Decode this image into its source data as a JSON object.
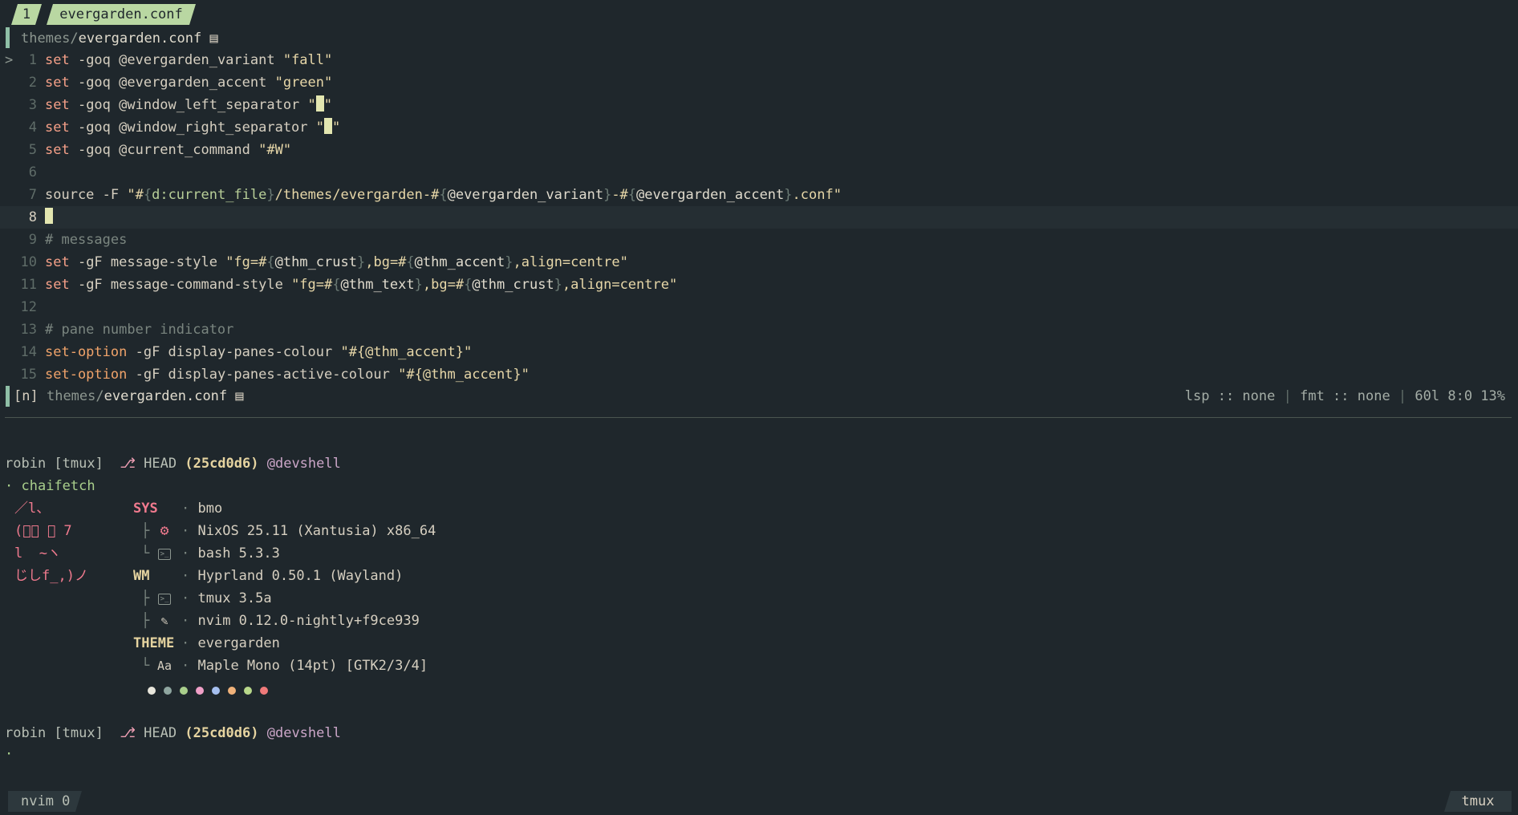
{
  "tabline": {
    "index": "1",
    "name": "evergarden.conf"
  },
  "winbar": {
    "dir": "themes/",
    "file": "evergarden.conf"
  },
  "code": {
    "l1": {
      "n": "1",
      "a": "set",
      "b": " -goq @evergarden_variant ",
      "c": "\"fall\""
    },
    "l2": {
      "n": "2",
      "a": "set",
      "b": " -goq @evergarden_accent ",
      "c": "\"green\""
    },
    "l3": {
      "n": "3",
      "a": "set",
      "b": " -goq @window_left_separator ",
      "c": "\"",
      "d": "\""
    },
    "l4": {
      "n": "4",
      "a": "set",
      "b": " -goq @window_right_separator ",
      "c": "\"",
      "d": "\""
    },
    "l5": {
      "n": "5",
      "a": "set",
      "b": " -goq @current_command ",
      "c": "\"#W\""
    },
    "l6": {
      "n": "6"
    },
    "l7": {
      "n": "7",
      "a": "source -F ",
      "b": "\"#",
      "c": "{",
      "d": "d:current_file",
      "e": "}",
      "f": "/themes/evergarden-#",
      "g": "{",
      "h": "@evergarden_variant",
      "i": "}",
      "j": "-#",
      "k": "{",
      "l": "@evergarden_accent",
      "m": "}",
      "o": ".conf\""
    },
    "l8": {
      "n": "8"
    },
    "l9": {
      "n": "9",
      "a": "# messages"
    },
    "l10": {
      "n": "10",
      "a": "set",
      "b": " -gF message-style ",
      "c": "\"fg=#",
      "d": "{",
      "e": "@thm_crust",
      "f": "}",
      "g": ",bg=#",
      "h": "{",
      "i": "@thm_accent",
      "j": "}",
      "k": ",align=centre\""
    },
    "l11": {
      "n": "11",
      "a": "set",
      "b": " -gF message-command-style ",
      "c": "\"fg=#",
      "d": "{",
      "e": "@thm_text",
      "f": "}",
      "g": ",bg=#",
      "h": "{",
      "i": "@thm_crust",
      "j": "}",
      "k": ",align=centre\""
    },
    "l12": {
      "n": "12"
    },
    "l13": {
      "n": "13",
      "a": "# pane number indicator"
    },
    "l14": {
      "n": "14",
      "a": "set-option",
      "b": " -gF display-panes-colour ",
      "c": "\"#{@thm_accent}\""
    },
    "l15": {
      "n": "15",
      "a": "set-option",
      "b": " -gF display-panes-active-colour ",
      "c": "\"#{@thm_accent}\""
    }
  },
  "gutter_sign": ">",
  "statusline": {
    "mode": "[n]",
    "dir": "themes/",
    "file": "evergarden.conf",
    "lsp": "lsp :: none",
    "sep": " | ",
    "fmt": "fmt :: none",
    "pos": "60l 8:0 13%"
  },
  "shell": {
    "prompt1": {
      "user": "robin [tmux]",
      "branch_icon": "⎇",
      "head": "HEAD",
      "hash": "(25cd0d6)",
      "env": "@devshell"
    },
    "cmd_dot": "·",
    "cmd": "chaifetch",
    "art": [
      "／l、",
      "(ﾟ､ ｡ 7",
      "l  ~ヽ",
      "じしf_,)ノ"
    ],
    "labels": {
      "sys": "SYS",
      "wm": "WM",
      "theme": "THEME"
    },
    "info": {
      "host": "bmo",
      "os": "NixOS 25.11 (Xantusia) x86_64",
      "shell": "bash 5.3.3",
      "wm": "Hyprland 0.50.1 (Wayland)",
      "term": "tmux 3.5a",
      "editor": "nvim 0.12.0-nightly+f9ce939",
      "theme": "evergarden",
      "font": "Maple Mono (14pt) [GTK2/3/4]"
    },
    "font_icon": "Aa",
    "palette": [
      "#e8e6dc",
      "#8fa6a0",
      "#a9cf8c",
      "#f0a0c8",
      "#a6c0f0",
      "#f0b27a",
      "#b8d88a",
      "#f07a7a"
    ],
    "prompt2": {
      "user": "robin [tmux]",
      "branch_icon": "⎇",
      "head": "HEAD",
      "hash": "(25cd0d6)",
      "env": "@devshell"
    },
    "cursor_dot": "·"
  },
  "tmux": {
    "left": "nvim 0",
    "right": "tmux"
  }
}
